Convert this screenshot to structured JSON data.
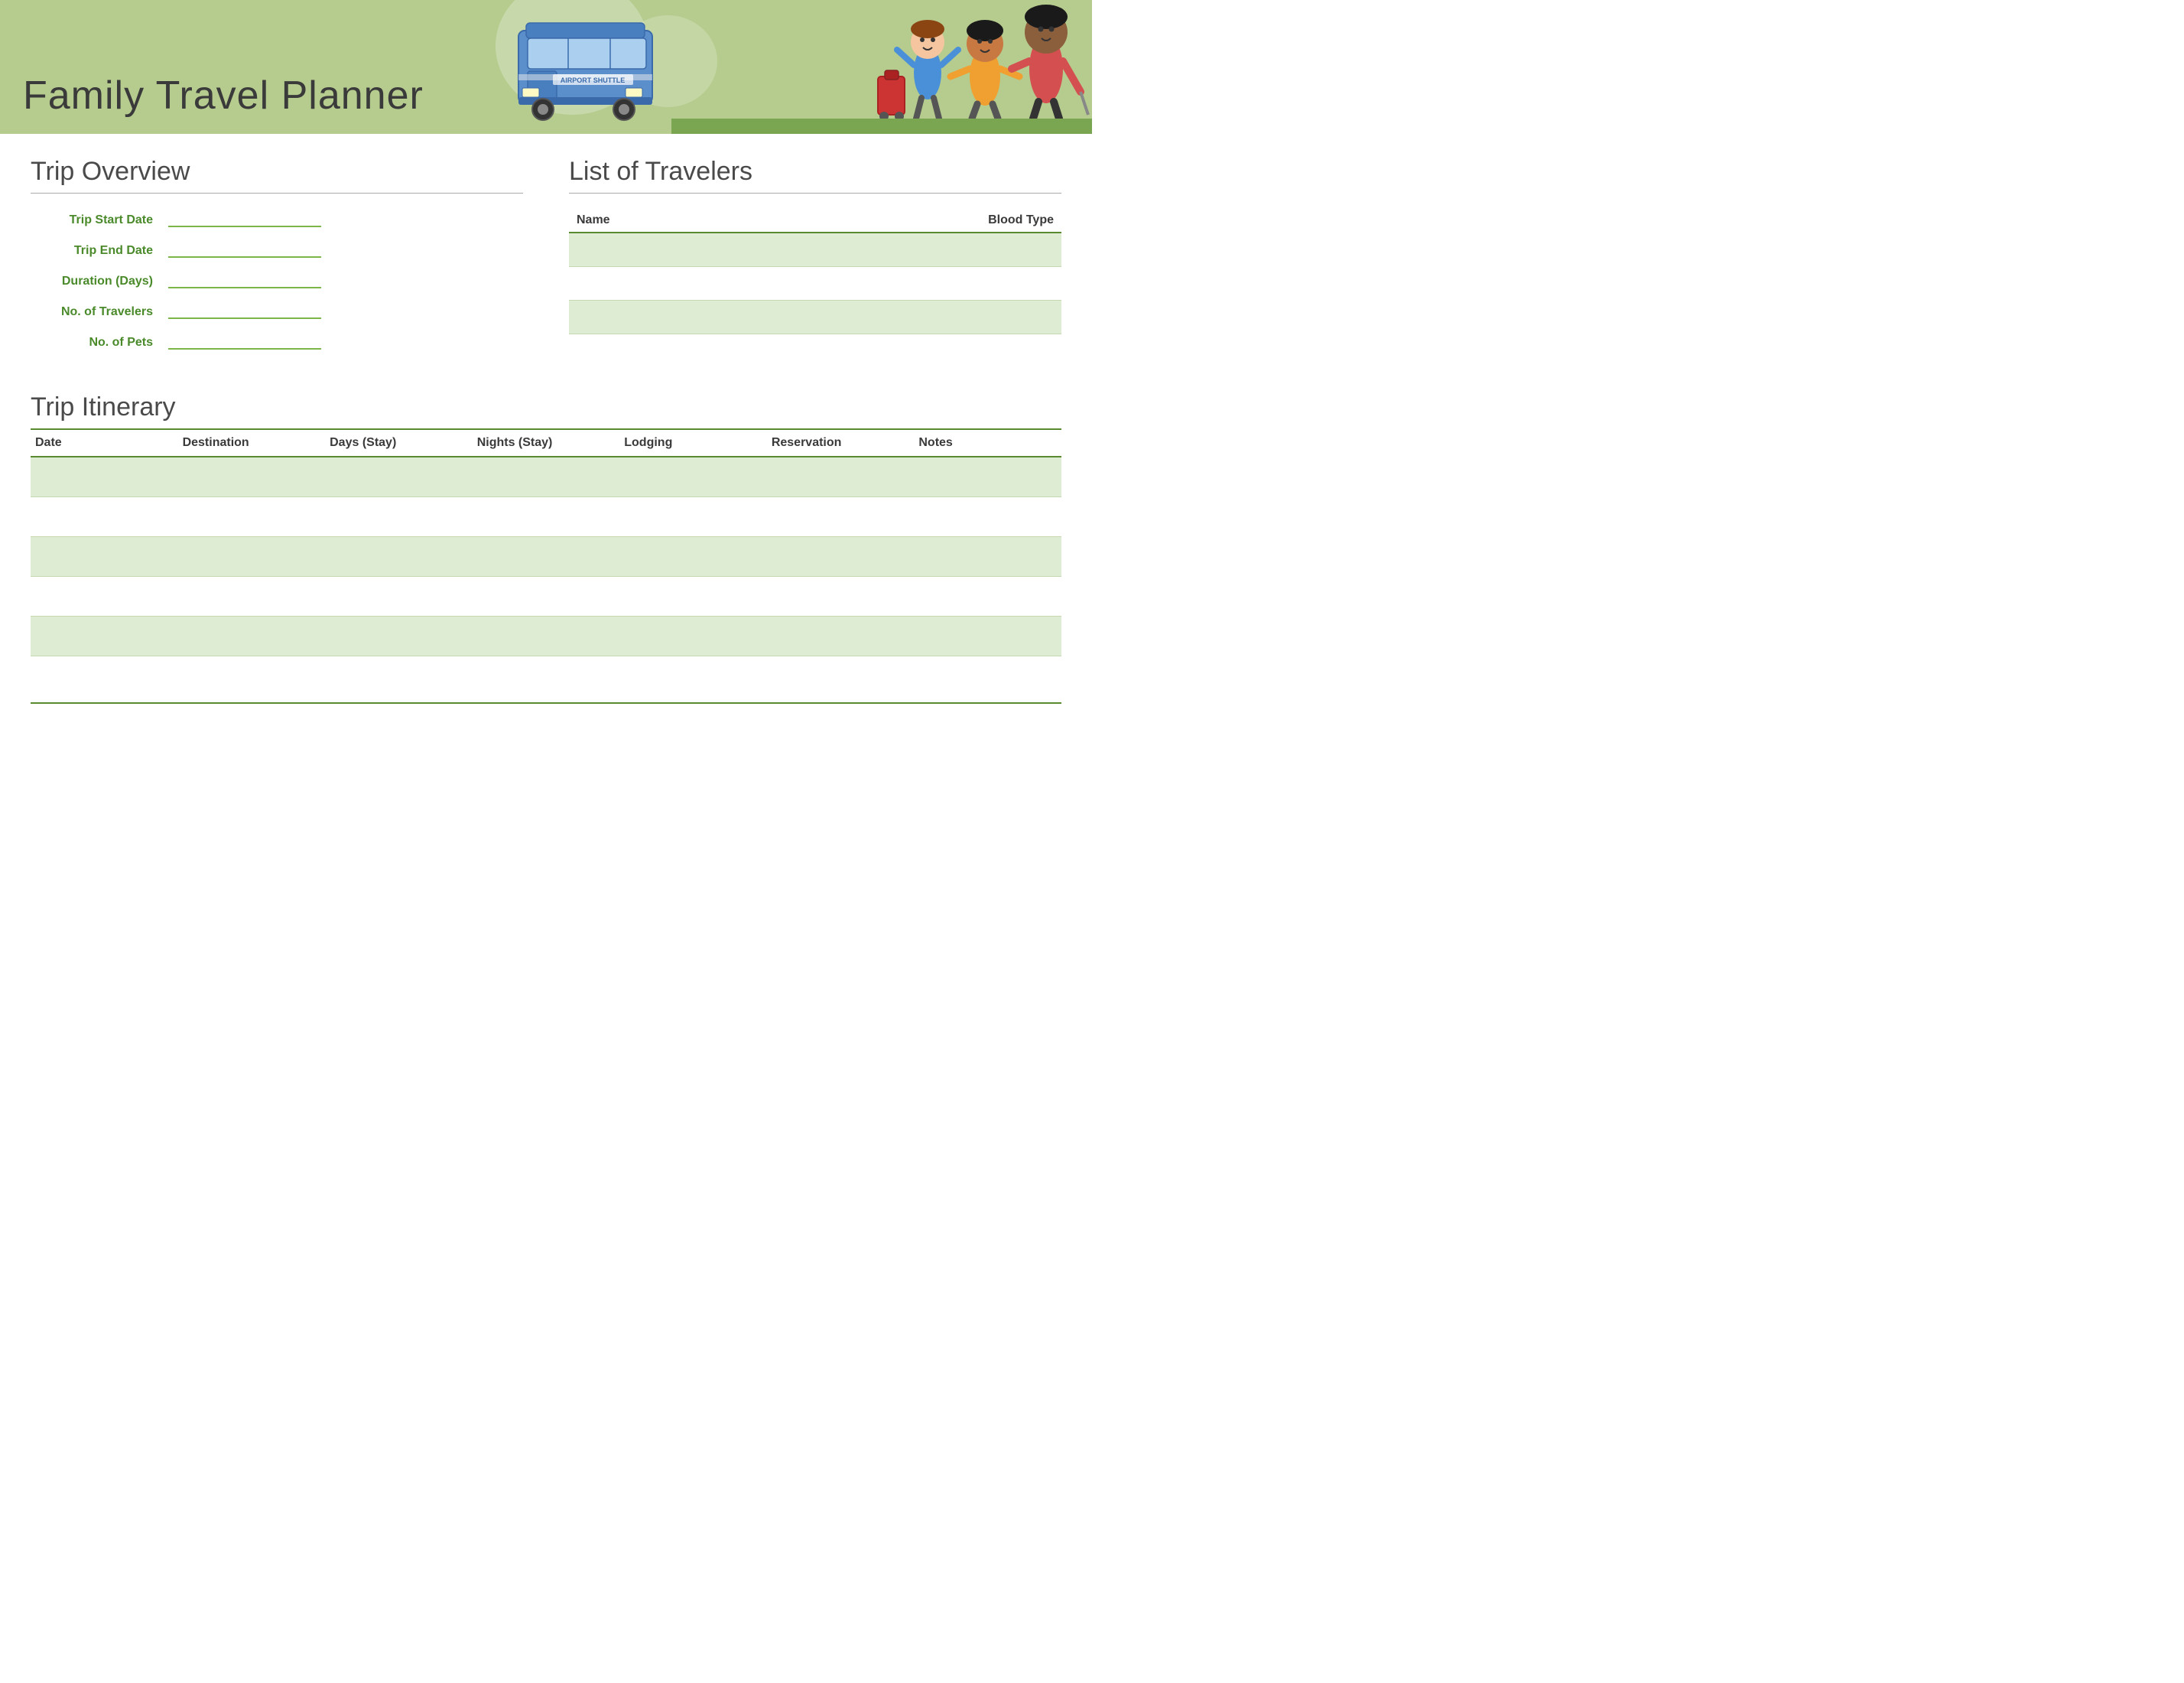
{
  "header": {
    "title": "Family Travel Planner"
  },
  "trip_overview": {
    "section_title": "Trip Overview",
    "fields": [
      {
        "label": "Trip Start Date",
        "value": ""
      },
      {
        "label": "Trip End Date",
        "value": ""
      },
      {
        "label": "Duration (Days)",
        "value": ""
      },
      {
        "label": "No. of Travelers",
        "value": ""
      },
      {
        "label": "No. of Pets",
        "value": ""
      }
    ]
  },
  "travelers": {
    "section_title": "List of Travelers",
    "columns": [
      "Name",
      "Blood Type"
    ],
    "rows": [
      {
        "name": "",
        "blood_type": "",
        "shaded": true
      },
      {
        "name": "",
        "blood_type": "",
        "shaded": false
      },
      {
        "name": "",
        "blood_type": "",
        "shaded": true
      }
    ]
  },
  "itinerary": {
    "section_title": "Trip Itinerary",
    "columns": [
      "Date",
      "Destination",
      "Days (Stay)",
      "Nights (Stay)",
      "Lodging",
      "Reservation",
      "Notes"
    ],
    "rows": [
      {
        "shaded": true
      },
      {
        "shaded": false
      },
      {
        "shaded": true
      },
      {
        "shaded": false
      },
      {
        "shaded": true
      }
    ]
  }
}
